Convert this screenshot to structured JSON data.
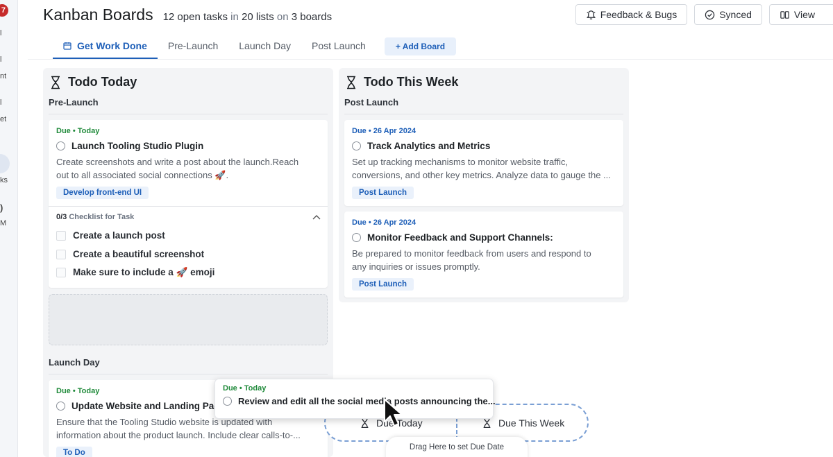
{
  "sidebar": {
    "badge": "7",
    "fragments": [
      "l",
      "l",
      "nt",
      "l",
      "et",
      "ks",
      ")",
      "M"
    ]
  },
  "header": {
    "title": "Kanban Boards",
    "summary_count_tasks": "12 open tasks",
    "summary_in": "in",
    "summary_count_lists": "20 lists",
    "summary_on": "on",
    "summary_count_boards": "3 boards",
    "actions": {
      "feedback": "Feedback & Bugs",
      "synced": "Synced",
      "view": "View"
    }
  },
  "tabs": [
    {
      "label": "Get Work Done",
      "active": true
    },
    {
      "label": "Pre-Launch"
    },
    {
      "label": "Launch Day"
    },
    {
      "label": "Post Launch"
    }
  ],
  "add_board": "+ Add Board",
  "columns": [
    {
      "title": "Todo Today",
      "groups": [
        {
          "label": "Pre-Launch",
          "cards": [
            {
              "due": "Due • Today",
              "title": "Launch Tooling Studio Plugin",
              "desc_line1": "Create screenshots and write a post about the launch.Reach",
              "desc_line2": "out to all associated social connections 🚀.",
              "tag": "Develop front-end UI",
              "checklist": {
                "count": "0/3",
                "label": "Checklist for Task",
                "items": [
                  "Create a launch post",
                  "Create a beautiful screenshot",
                  "Make sure to include a 🚀 emoji"
                ]
              }
            }
          ]
        },
        {
          "label": "Launch Day",
          "cards": [
            {
              "due": "Due • Today",
              "title": "Update Website and Landing Page",
              "desc_line1": "Ensure that the Tooling Studio website is updated with",
              "desc_line2": "information about the product launch.  Include clear calls-to-...",
              "tag": "To Do"
            }
          ]
        }
      ]
    },
    {
      "title": "Todo This Week",
      "groups": [
        {
          "label": "Post Launch",
          "cards": [
            {
              "due": "Due • 26 Apr 2024",
              "title": "Track Analytics and Metrics",
              "desc_line1": "Set up tracking mechanisms to monitor website traffic,",
              "desc_line2": "conversions, and other key metrics.  Analyze data to gauge the ...",
              "tag": "Post Launch"
            },
            {
              "due": "Due • 26 Apr 2024",
              "title": "Monitor Feedback and Support Channels:",
              "desc_line1": "Be prepared to monitor feedback from users and respond to",
              "desc_line2": "any inquiries or issues promptly.",
              "tag": "Post Launch"
            }
          ]
        }
      ]
    }
  ],
  "drag": {
    "due": "Due • Today",
    "title": "Review and edit all the social media posts announcing the...",
    "target_today": "Due Today",
    "target_week": "Due This Week",
    "hint": "Drag Here to set Due Date"
  }
}
